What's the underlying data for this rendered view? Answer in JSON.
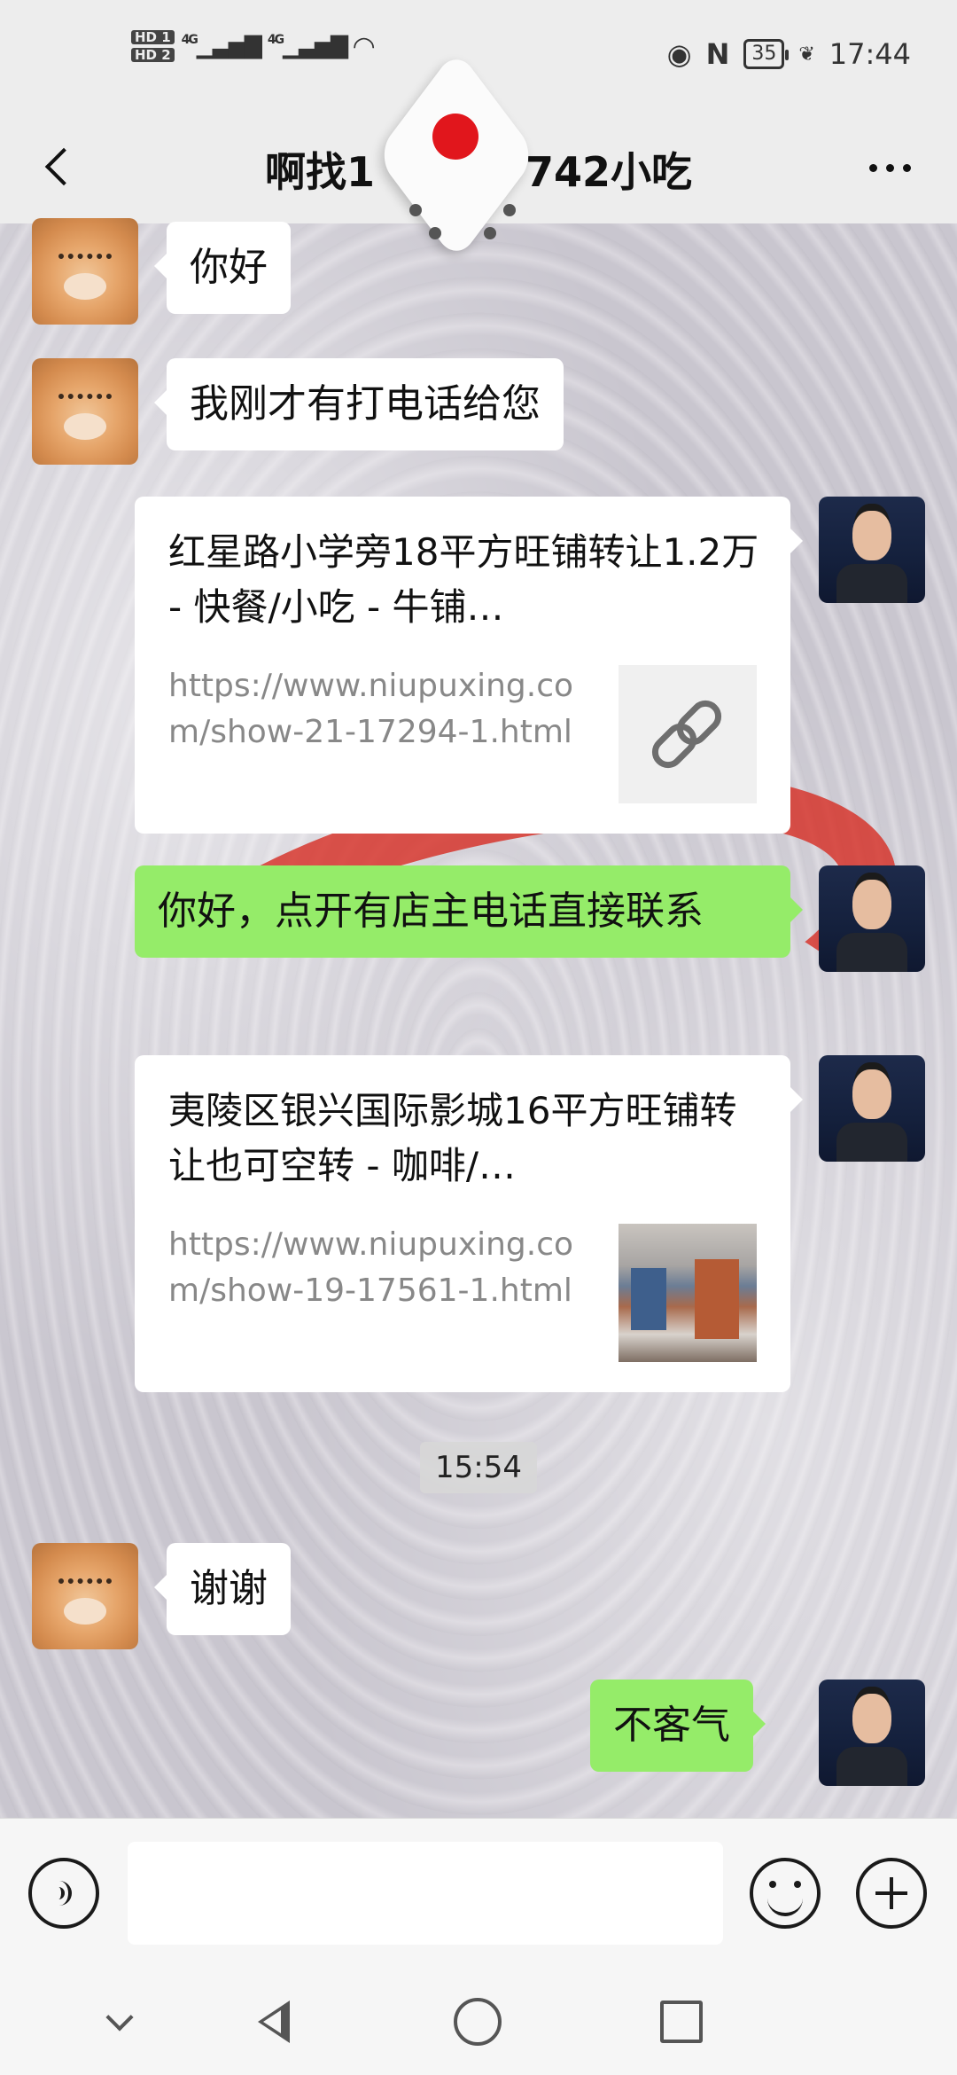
{
  "status_bar": {
    "hd1": "HD 1",
    "hd2": "HD 2",
    "net1": "4G",
    "net2": "4G",
    "battery": "35",
    "time": "17:44"
  },
  "header": {
    "title": "啊找1",
    "title_suffix": "742小吃"
  },
  "messages": [
    {
      "side": "left",
      "type": "text",
      "text": "你好"
    },
    {
      "side": "left",
      "type": "text",
      "text": "我刚才有打电话给您"
    },
    {
      "side": "right",
      "type": "link",
      "title": "红星路小学旁18平方旺铺转让1.2万 - 快餐/小吃 - 牛铺…",
      "url": "https://www.niupuxing.com/show-21-17294-1.html",
      "thumb": "link-icon"
    },
    {
      "side": "right",
      "type": "text",
      "text": "你好，点开有店主电话直接联系"
    },
    {
      "side": "right",
      "type": "link",
      "title": "夷陵区银兴国际影城16平方旺铺转让也可空转 - 咖啡/…",
      "url": "https://www.niupuxing.com/show-19-17561-1.html",
      "thumb": "photo"
    },
    {
      "type": "time",
      "text": "15:54"
    },
    {
      "side": "left",
      "type": "text",
      "text": "谢谢"
    },
    {
      "side": "right",
      "type": "text",
      "text": "不客气"
    }
  ],
  "input_bar": {
    "placeholder": ""
  },
  "colors": {
    "sent_bubble": "#95ec69",
    "received_bubble": "#ffffff",
    "dice_pip": "#e1161c"
  }
}
